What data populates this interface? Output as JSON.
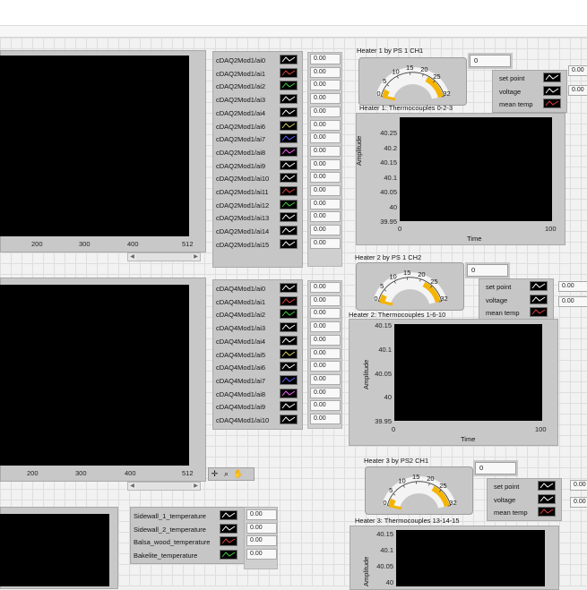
{
  "graph_axes": {
    "x_top": [
      "200",
      "300",
      "400",
      "512"
    ],
    "x_mid": [
      "200",
      "300",
      "400",
      "512"
    ]
  },
  "channels_mod2": [
    "cDAQ2Mod1/ai0",
    "cDAQ2Mod1/ai1",
    "cDAQ2Mod1/ai2",
    "cDAQ2Mod1/ai3",
    "cDAQ2Mod1/ai4",
    "cDAQ2Mod1/ai6",
    "cDAQ2Mod1/ai7",
    "cDAQ2Mod1/ai8",
    "cDAQ2Mod1/ai9",
    "cDAQ2Mod1/ai10",
    "cDAQ2Mod1/ai11",
    "cDAQ2Mod1/ai12",
    "cDAQ2Mod1/ai13",
    "cDAQ2Mod1/ai14",
    "cDAQ2Mod1/ai15"
  ],
  "channels_mod2_colors": [
    "#ffffff",
    "#e04040",
    "#40d040",
    "#ffffff",
    "#ffffff",
    "#d0d060",
    "#6060ff",
    "#ff60ff",
    "#ffffff",
    "#ffffff",
    "#e04040",
    "#40d040",
    "#ffffff",
    "#ffffff",
    "#ffffff"
  ],
  "channels_mod4": [
    "cDAQ4Mod1/ai0",
    "cDAQ4Mod1/ai1",
    "cDAQ4Mod1/ai2",
    "cDAQ4Mod1/ai3",
    "cDAQ4Mod1/ai4",
    "cDAQ4Mod1/ai5",
    "cDAQ4Mod1/ai6",
    "cDAQ4Mod1/ai7",
    "cDAQ4Mod1/ai8",
    "cDAQ4Mod1/ai9",
    "cDAQ4Mod1/ai10"
  ],
  "channels_mod4_colors": [
    "#ffffff",
    "#e04040",
    "#40d040",
    "#ffffff",
    "#ffffff",
    "#d0d060",
    "#ffffff",
    "#6060ff",
    "#ff60ff",
    "#ffffff",
    "#ffffff"
  ],
  "channel_value": "0.00",
  "temperatures": {
    "names": [
      "Sidewall_1_temperature",
      "Sidewall_2_temperature",
      "Balsa_wood_temperature",
      "Bakelite_temperature"
    ],
    "colors": [
      "#ffffff",
      "#ffffff",
      "#e04040",
      "#40d040"
    ],
    "values": [
      "0.00",
      "0.00",
      "0.00",
      "0.00"
    ]
  },
  "gauge_scale": [
    "0",
    "5",
    "10",
    "15",
    "20",
    "25",
    "32"
  ],
  "legend_labels": [
    "set point",
    "voltage",
    "mean temp"
  ],
  "legend_colors": [
    "#ffffff",
    "#ffffff",
    "#e04040"
  ],
  "heater1": {
    "title": "Heater 1 by PS 1 CH1",
    "value": "0",
    "side_values": [
      "0.00",
      "0.00"
    ],
    "chart_title": "Heater 1: Thermocouples 0-2-3",
    "ylabel": "Amplitude",
    "xlabel": "Time",
    "yticks": [
      "40.25",
      "40.2",
      "40.15",
      "40.1",
      "40.05",
      "40",
      "39.95"
    ],
    "xticks": [
      "0",
      "100"
    ]
  },
  "heater2": {
    "title": "Heater 2 by PS 1 CH2",
    "value": "0",
    "side_values": [
      "0.00",
      "0.00"
    ],
    "chart_title": "Heater 2: Thermocouples 1-6-10",
    "ylabel": "Amplitude",
    "xlabel": "Time",
    "yticks": [
      "40.15",
      "40.1",
      "40.05",
      "40",
      "39.95"
    ],
    "xticks": [
      "0",
      "100"
    ]
  },
  "heater3": {
    "title": "Heater 3 by PS2 CH1",
    "value": "0",
    "side_values": [
      "0.00",
      "0.00"
    ],
    "chart_title": "Heater 3: Thermocouples 13-14-15",
    "ylabel": "Amplitude",
    "yticks": [
      "40.15",
      "40.1",
      "40.05",
      "40"
    ]
  }
}
